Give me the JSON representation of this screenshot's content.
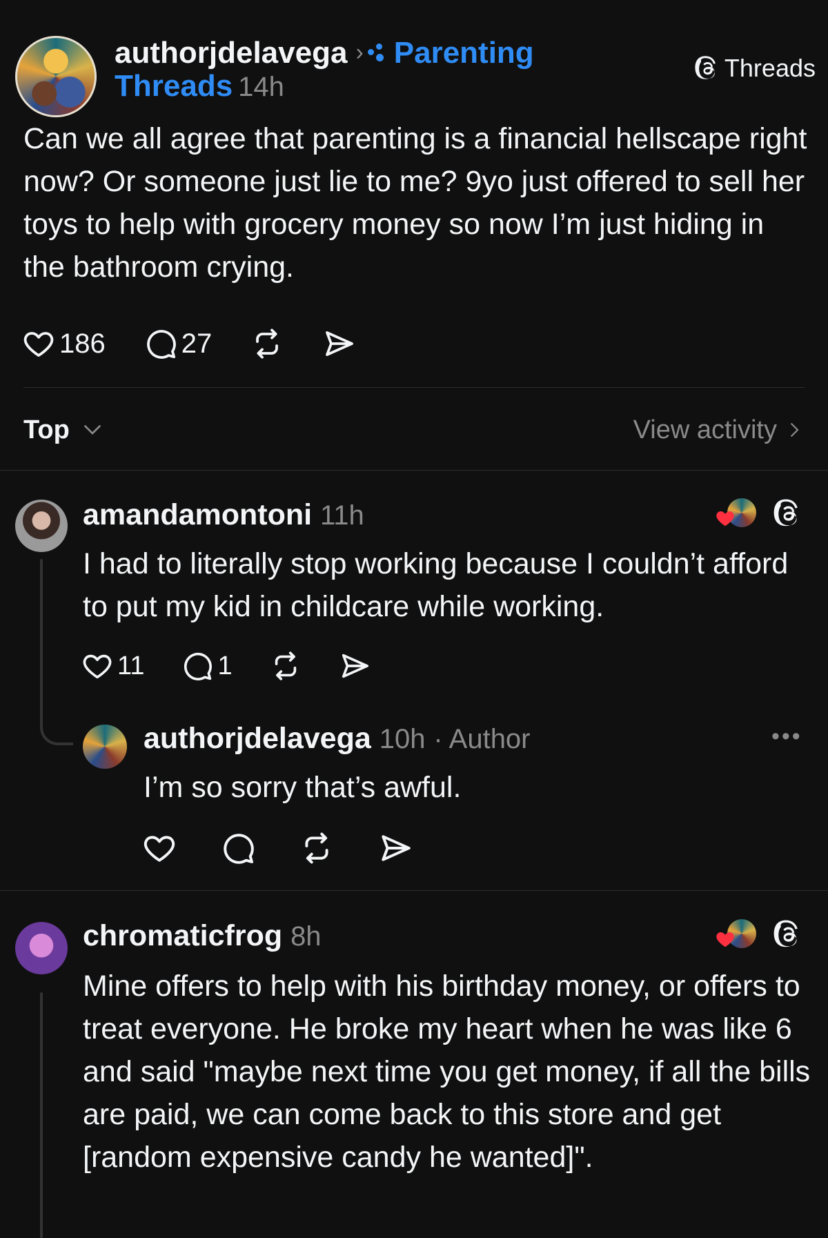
{
  "post": {
    "username": "authorjdelavega",
    "community_name": "Parenting",
    "community_suffix": "Threads",
    "time": "14h",
    "brand": "Threads",
    "text": "Can we all agree that parenting is a financial hellscape right now? Or someone just lie to me? 9yo just offered to sell her toys to help with grocery money so now I’m just hiding in the bathroom crying.",
    "likes": "186",
    "comments": "27"
  },
  "sort": {
    "label": "Top",
    "view_activity": "View activity"
  },
  "replies": [
    {
      "username": "amandamontoni",
      "time": "11h",
      "text": "I had to literally stop working because I couldn’t afford to put my kid in childcare while working.",
      "likes": "11",
      "comments": "1"
    },
    {
      "username": "authorjdelavega",
      "time": "10h",
      "tag": "· Author",
      "text": "I’m so sorry that’s awful."
    },
    {
      "username": "chromaticfrog",
      "time": "8h",
      "text": "Mine offers to help with his birthday money, or offers to treat everyone. He broke my heart when he was like 6 and said \"maybe next time you get money, if all the bills are paid, we can come back to this store and get [random expensive candy he wanted]\"."
    }
  ],
  "icons": {
    "like": "heart-icon",
    "comment": "comment-bubble-icon",
    "repost": "repost-icon",
    "share": "share-send-icon",
    "threads": "threads-logo-icon",
    "more": "more-dots-icon"
  },
  "colors": {
    "background": "#101010",
    "text": "#f3f5f7",
    "muted": "#8a8a8a",
    "accent": "#2f8cf5",
    "heart": "#ff3040"
  }
}
